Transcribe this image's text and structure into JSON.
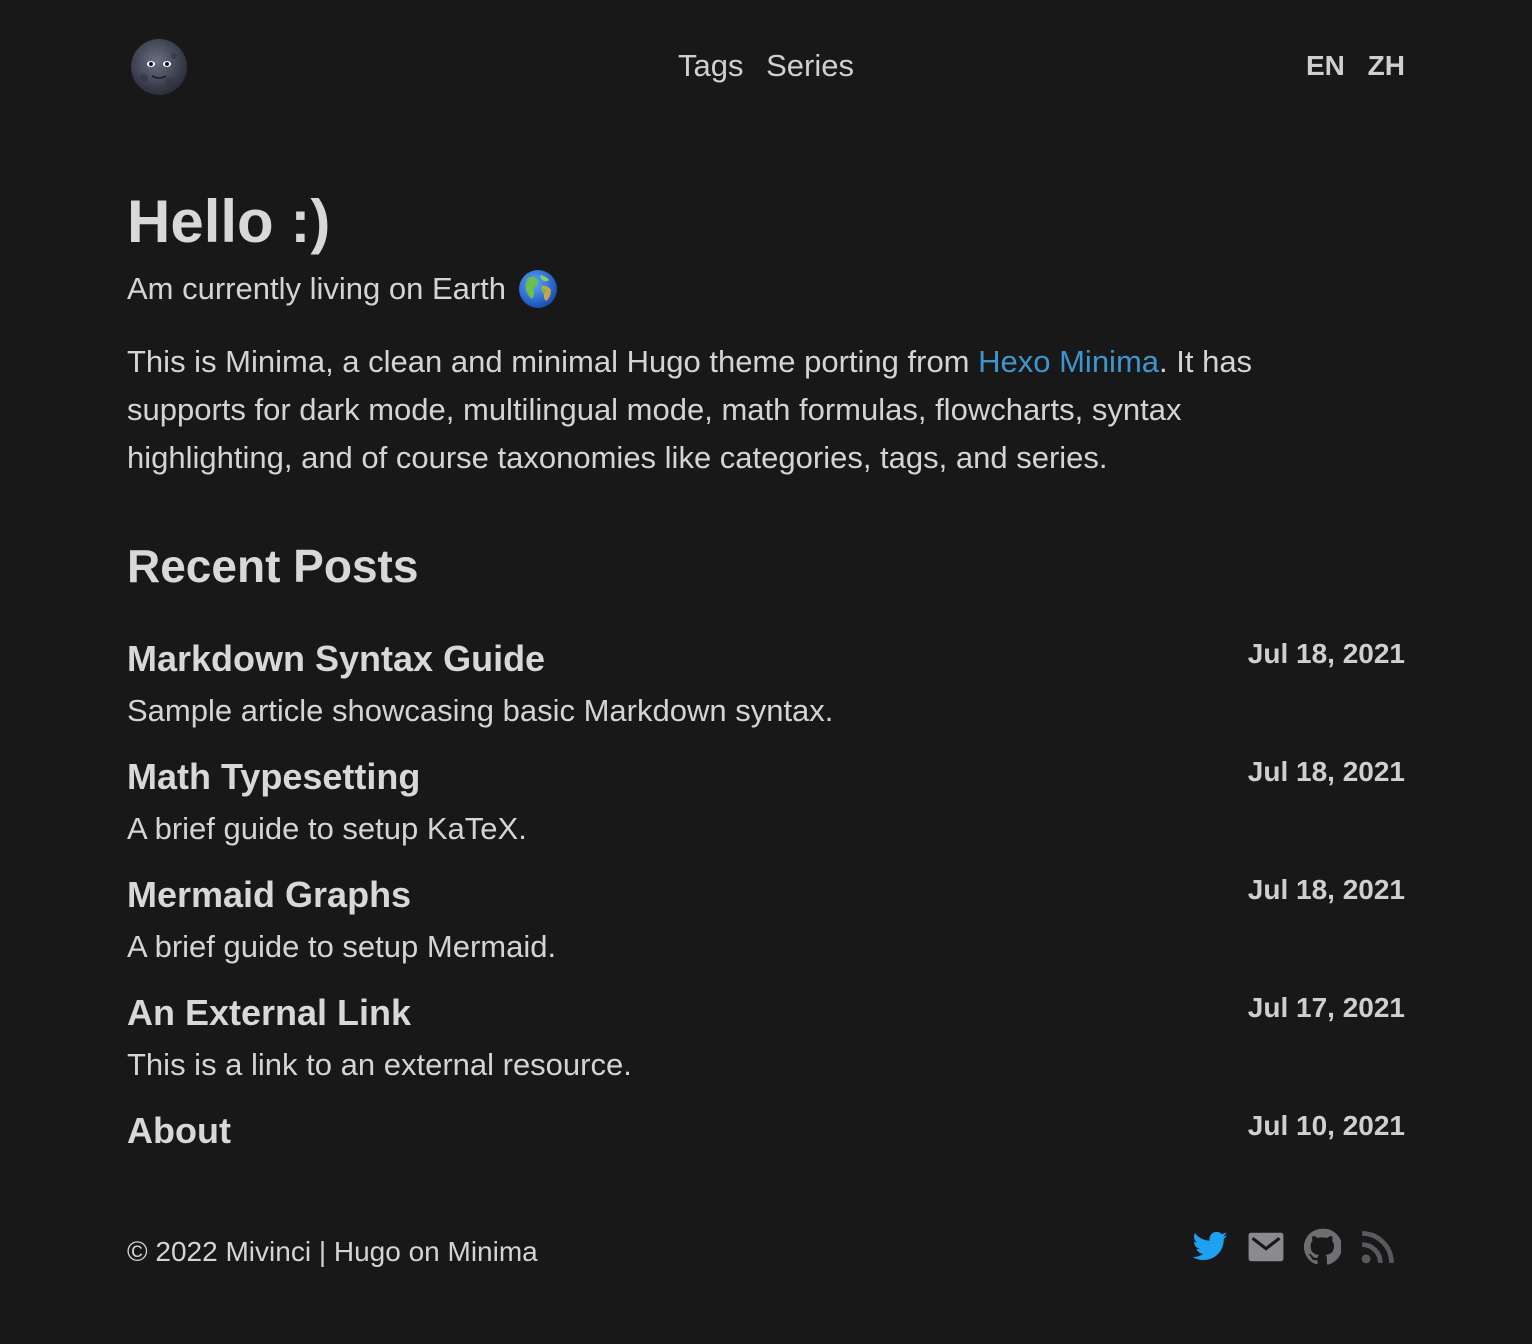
{
  "header": {
    "nav": [
      {
        "label": "Tags"
      },
      {
        "label": "Series"
      }
    ],
    "languages": [
      {
        "label": "EN"
      },
      {
        "label": "ZH"
      }
    ]
  },
  "intro": {
    "title": "Hello :)",
    "subtitle": "Am currently living on Earth",
    "description_before": "This is Minima, a clean and minimal Hugo theme porting from ",
    "description_link": "Hexo Minima",
    "description_after": ". It has supports for dark mode, multilingual mode, math formulas, flowcharts, syntax highlighting, and of course taxonomies like categories, tags, and series."
  },
  "recent": {
    "heading": "Recent Posts",
    "posts": [
      {
        "title": "Markdown Syntax Guide",
        "summary": "Sample article showcasing basic Markdown syntax.",
        "date": "Jul 18, 2021"
      },
      {
        "title": "Math Typesetting",
        "summary": "A brief guide to setup KaTeX.",
        "date": "Jul 18, 2021"
      },
      {
        "title": "Mermaid Graphs",
        "summary": "A brief guide to setup Mermaid.",
        "date": "Jul 18, 2021"
      },
      {
        "title": "An External Link",
        "summary": "This is a link to an external resource.",
        "date": "Jul 17, 2021"
      },
      {
        "title": "About",
        "summary": "",
        "date": "Jul 10, 2021"
      }
    ]
  },
  "footer": {
    "copyright": "© 2022 Mivinci | Hugo on Minima",
    "social": [
      {
        "icon": "twitter-icon",
        "color": "#1da1f2"
      },
      {
        "icon": "mail-icon",
        "color": "#8a8a8f"
      },
      {
        "icon": "github-icon",
        "color": "#6e6e73"
      },
      {
        "icon": "rss-icon",
        "color": "#5a5a5e"
      }
    ]
  },
  "colors": {
    "background": "#181818",
    "text": "#d4d4d4",
    "link": "#3e95cd"
  }
}
